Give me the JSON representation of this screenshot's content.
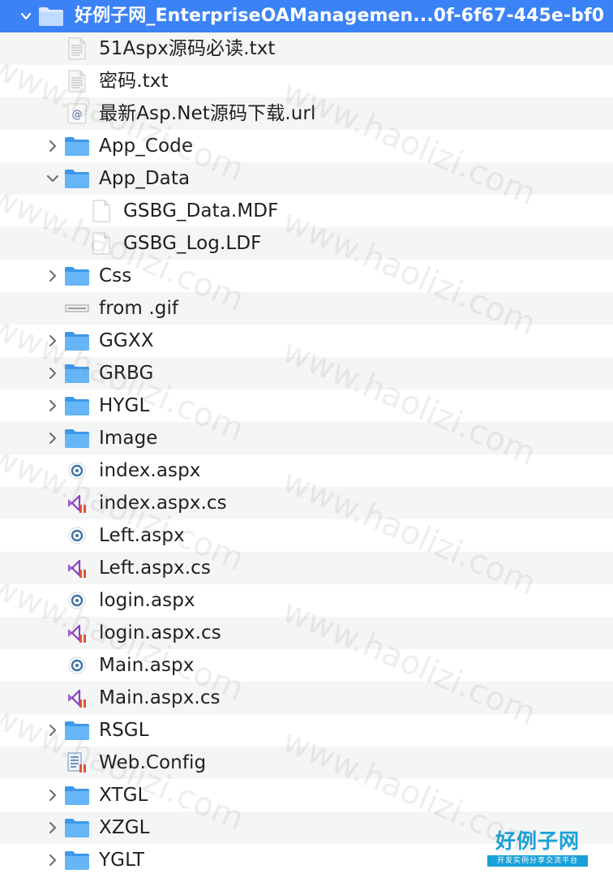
{
  "tree": {
    "root": {
      "label": "好例子网_EnterpriseOAManagemen...0f-6f67-445e-bf0",
      "icon": "folder-icon",
      "expanded": true
    },
    "items": [
      {
        "label": "51Aspx源码必读.txt",
        "icon": "text-document-icon",
        "level": 1
      },
      {
        "label": "密码.txt",
        "icon": "text-document-icon",
        "level": 1
      },
      {
        "label": "最新Asp.Net源码下载.url",
        "icon": "url-file-icon",
        "level": 1
      },
      {
        "label": "App_Code",
        "icon": "folder-icon",
        "level": 1,
        "folder": true,
        "expanded": false
      },
      {
        "label": "App_Data",
        "icon": "folder-icon",
        "level": 1,
        "folder": true,
        "expanded": true
      },
      {
        "label": "GSBG_Data.MDF",
        "icon": "blank-document-icon",
        "level": 2
      },
      {
        "label": "GSBG_Log.LDF",
        "icon": "blank-document-icon",
        "level": 2
      },
      {
        "label": "Css",
        "icon": "folder-icon",
        "level": 1,
        "folder": true,
        "expanded": false
      },
      {
        "label": "from .gif",
        "icon": "image-file-icon",
        "level": 1
      },
      {
        "label": "GGXX",
        "icon": "folder-icon",
        "level": 1,
        "folder": true,
        "expanded": false
      },
      {
        "label": "GRBG",
        "icon": "folder-icon",
        "level": 1,
        "folder": true,
        "expanded": false
      },
      {
        "label": "HYGL",
        "icon": "folder-icon",
        "level": 1,
        "folder": true,
        "expanded": false
      },
      {
        "label": "Image",
        "icon": "folder-icon",
        "level": 1,
        "folder": true,
        "expanded": false
      },
      {
        "label": "index.aspx",
        "icon": "aspx-file-icon",
        "level": 1
      },
      {
        "label": "index.aspx.cs",
        "icon": "csharp-file-icon",
        "level": 1
      },
      {
        "label": "Left.aspx",
        "icon": "aspx-file-icon",
        "level": 1
      },
      {
        "label": "Left.aspx.cs",
        "icon": "csharp-file-icon",
        "level": 1
      },
      {
        "label": "login.aspx",
        "icon": "aspx-file-icon",
        "level": 1
      },
      {
        "label": "login.aspx.cs",
        "icon": "csharp-file-icon",
        "level": 1
      },
      {
        "label": "Main.aspx",
        "icon": "aspx-file-icon",
        "level": 1
      },
      {
        "label": "Main.aspx.cs",
        "icon": "csharp-file-icon",
        "level": 1
      },
      {
        "label": "RSGL",
        "icon": "folder-icon",
        "level": 1,
        "folder": true,
        "expanded": false
      },
      {
        "label": "Web.Config",
        "icon": "config-file-icon",
        "level": 1
      },
      {
        "label": "XTGL",
        "icon": "folder-icon",
        "level": 1,
        "folder": true,
        "expanded": false
      },
      {
        "label": "XZGL",
        "icon": "folder-icon",
        "level": 1,
        "folder": true,
        "expanded": false
      },
      {
        "label": "YGLT",
        "icon": "folder-icon",
        "level": 1,
        "folder": true,
        "expanded": false
      }
    ]
  },
  "watermark": {
    "text": "www.haolizi.com"
  },
  "logo": {
    "title": "好例子网",
    "tagline": "开发实例分享交流平台"
  },
  "colors": {
    "selection": "#3b82f6",
    "folder": "#5aaef5",
    "alt_row": "#f4f5f5"
  }
}
